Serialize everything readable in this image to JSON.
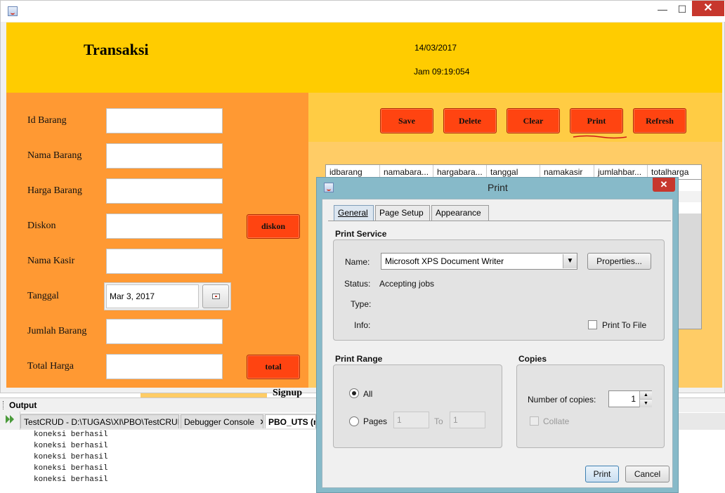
{
  "window": {
    "title": "",
    "controls": {
      "minimize": "—",
      "maximize": "☐",
      "close": "✕"
    }
  },
  "header": {
    "title": "Transaksi",
    "date": "14/03/2017",
    "time": "Jam 09:19:054"
  },
  "form": {
    "fields": [
      {
        "label": "Id Barang",
        "value": ""
      },
      {
        "label": "Nama Barang",
        "value": ""
      },
      {
        "label": "Harga Barang",
        "value": ""
      },
      {
        "label": "Diskon",
        "value": ""
      },
      {
        "label": "Nama Kasir",
        "value": ""
      },
      {
        "label": "Tanggal",
        "value": "Mar 3, 2017"
      },
      {
        "label": "Jumlah Barang",
        "value": ""
      },
      {
        "label": "Total Harga",
        "value": ""
      }
    ],
    "diskon_button": "diskon",
    "total_button": "total"
  },
  "actions": {
    "save": "Save",
    "delete": "Delete",
    "clear": "Clear",
    "print": "Print",
    "refresh": "Refresh"
  },
  "table": {
    "columns": [
      "idbarang",
      "namabara...",
      "hargabara...",
      "tanggal",
      "namakasir",
      "jumlahbar...",
      "totalharga"
    ]
  },
  "output": {
    "title": "Output",
    "tabs": [
      {
        "label": "TestCRUD - D:\\TUGAS\\XI\\PBO\\TestCRUD",
        "close": "✕"
      },
      {
        "label": "Debugger Console",
        "close": "✕"
      },
      {
        "label": "PBO_UTS (ru"
      }
    ],
    "lines": [
      "koneksi berhasil",
      "koneksi berhasil",
      "koneksi berhasil",
      "koneksi berhasil",
      "koneksi berhasil"
    ],
    "partial_text": "Signup"
  },
  "print_dialog": {
    "title": "Print",
    "close": "✕",
    "tabs": [
      "General",
      "Page Setup",
      "Appearance"
    ],
    "active_tab": "General",
    "print_service": {
      "heading": "Print Service",
      "name_label": "Name:",
      "printer": "Microsoft XPS Document Writer",
      "properties_button": "Properties...",
      "status_label": "Status:",
      "status_value": "Accepting jobs",
      "type_label": "Type:",
      "info_label": "Info:",
      "print_to_file": "Print To File",
      "print_to_file_checked": false
    },
    "print_range": {
      "heading": "Print Range",
      "all_label": "All",
      "pages_label": "Pages",
      "from_value": "1",
      "to_label": "To",
      "to_value": "1",
      "selected": "All"
    },
    "copies": {
      "heading": "Copies",
      "number_label": "Number of copies:",
      "number_value": "1",
      "collate_label": "Collate",
      "collate_checked": false
    },
    "print_button": "Print",
    "cancel_button": "Cancel"
  },
  "colors": {
    "header": "#ffcc00",
    "left_panel": "#ff9933",
    "button": "#ff4411",
    "dialog_frame": "#87bac9"
  }
}
